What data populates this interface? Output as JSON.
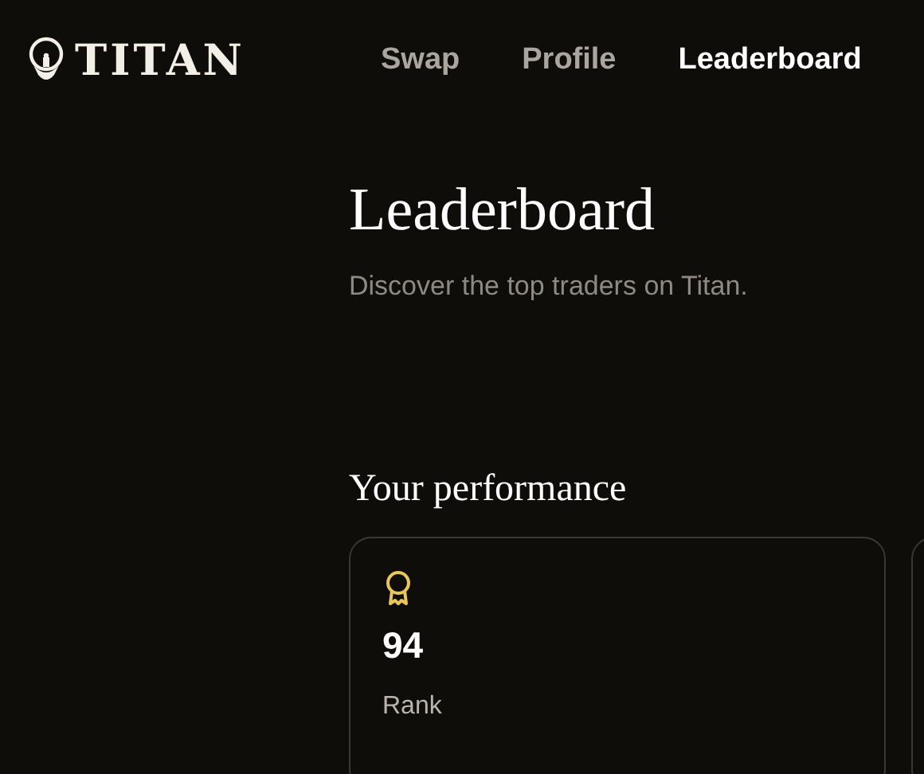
{
  "brand": {
    "name": "TITAN"
  },
  "nav": [
    {
      "label": "Swap",
      "selected": false
    },
    {
      "label": "Profile",
      "selected": false
    },
    {
      "label": "Leaderboard",
      "selected": true
    }
  ],
  "page": {
    "title": "Leaderboard",
    "subtitle": "Discover the top traders on Titan."
  },
  "performance": {
    "heading": "Your performance",
    "cards": [
      {
        "value": "94",
        "label": "Rank"
      }
    ]
  }
}
